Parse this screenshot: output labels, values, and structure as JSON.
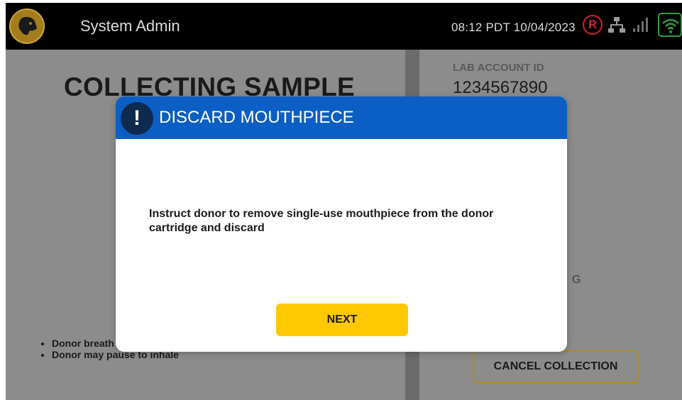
{
  "header": {
    "user": "System Admin",
    "datetime": "08:12 PDT 10/04/2023",
    "status_letter": "R"
  },
  "icons": {
    "logo": "dog-head-logo",
    "status": "registered-r-icon",
    "network": "network-icon",
    "signal": "signal-bars-icon",
    "wifi": "wifi-icon"
  },
  "main": {
    "title": "COLLECTING SAMPLE",
    "instructions": [
      "Donor breath",
      "Donor may pause to inhale"
    ]
  },
  "side": {
    "lab_label": "LAB ACCOUNT ID",
    "lab_value": "1234567890",
    "peek_text": "G",
    "cancel_label": "CANCEL COLLECTION"
  },
  "modal": {
    "icon": "!",
    "title": "DISCARD MOUTHPIECE",
    "message": "Instruct donor to remove single-use mouthpiece from the donor cartridge and discard",
    "next_label": "NEXT"
  },
  "colors": {
    "header_bg": "#000000",
    "modal_header": "#0b5fc4",
    "next_button": "#ffc800",
    "cancel_border": "#b08a1f",
    "status_red": "#d2232a",
    "wifi_green": "#2ea043"
  }
}
